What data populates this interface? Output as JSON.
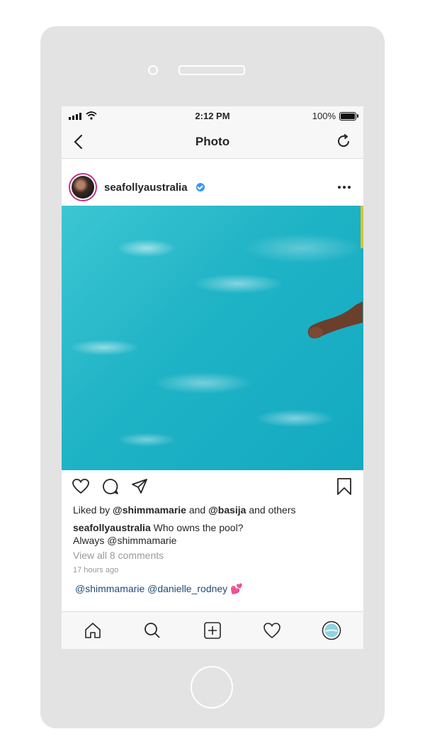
{
  "status_bar": {
    "time": "2:12 PM",
    "battery": "100%"
  },
  "nav": {
    "title": "Photo"
  },
  "post": {
    "username": "seafollyaustralia",
    "likes": {
      "prefix": "Liked by ",
      "user1": "@shimmamarie",
      "mid": " and ",
      "user2": "@basija",
      "suffix": " and others"
    },
    "caption": {
      "author": "seafollyaustralia",
      "text_line1": " Who owns the pool?",
      "text_line2": "Always @shimmamarie"
    },
    "view_all": "View all 8 comments",
    "time_ago": "17 hours ago",
    "comment": {
      "text": "@shimmamarie @danielle_rodney ",
      "emoji": "💕"
    }
  },
  "icons": {
    "back": "back-arrow-icon",
    "refresh": "refresh-icon",
    "more": "more-options-icon",
    "like": "heart-icon",
    "comment": "comment-icon",
    "share": "share-icon",
    "save": "bookmark-icon",
    "home": "home-icon",
    "search": "search-icon",
    "add": "add-post-icon",
    "activity": "activity-heart-icon",
    "profile": "profile-icon"
  },
  "colors": {
    "accent_link": "#1e4a78",
    "verified": "#3897f0",
    "water": "#1fb3c6"
  }
}
